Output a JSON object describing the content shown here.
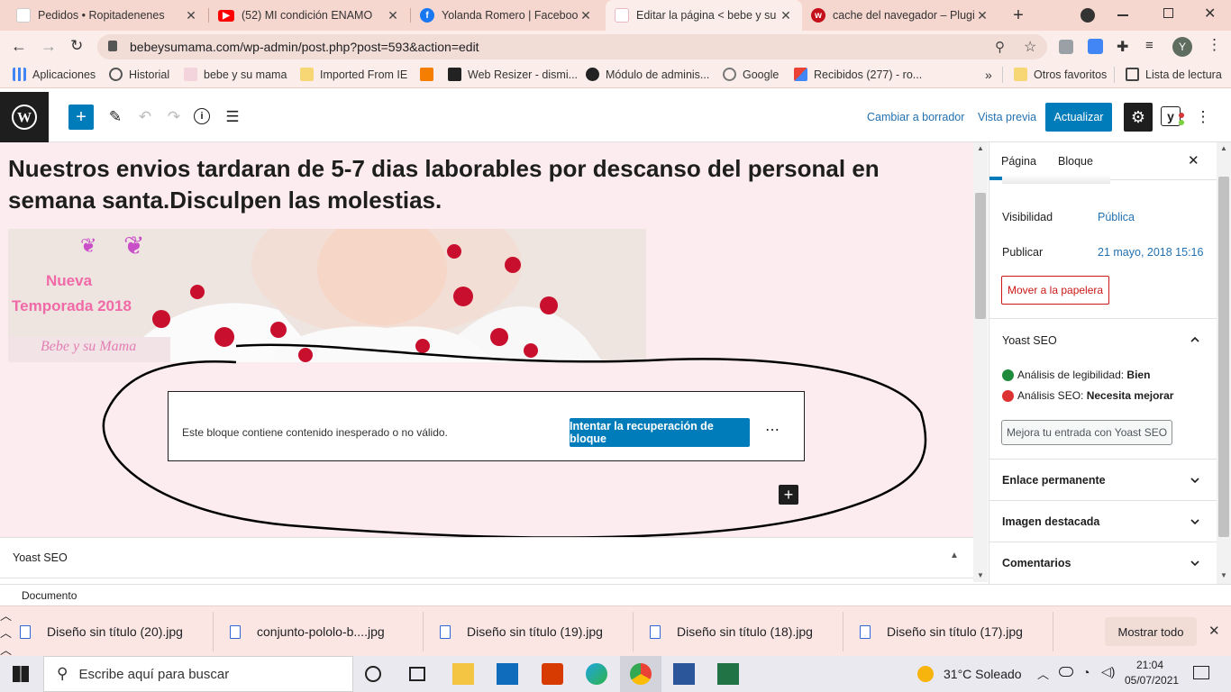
{
  "browser": {
    "tabs": [
      {
        "title": "Pedidos • Ropitadenenes",
        "icon": "page-icon",
        "active": false
      },
      {
        "title": "(52) MI condición ENAMO",
        "icon": "youtube-icon",
        "active": false
      },
      {
        "title": "Yolanda Romero | Facebook",
        "icon": "facebook-icon",
        "active": false
      },
      {
        "title": "Editar la página < bebe y su n",
        "icon": "site-icon",
        "active": true
      },
      {
        "title": "cache del navegador – Plugin",
        "icon": "plugin-icon",
        "active": false
      }
    ],
    "url": "bebeysumama.com/wp-admin/post.php?post=593&action=edit",
    "profile_initial": "Y",
    "bookmarks": [
      {
        "label": "Aplicaciones",
        "icon": "apps-icon"
      },
      {
        "label": "Historial",
        "icon": "history-icon"
      },
      {
        "label": "bebe y su mama",
        "icon": "site-icon"
      },
      {
        "label": "Imported From IE",
        "icon": "folder-icon"
      },
      {
        "label": "",
        "icon": "blogger-icon"
      },
      {
        "label": "Web Resizer - dismi...",
        "icon": "resizer-icon"
      },
      {
        "label": "Módulo de adminis...",
        "icon": "globe-icon"
      },
      {
        "label": "Google",
        "icon": "google-icon"
      },
      {
        "label": "Recibidos (277) - ro...",
        "icon": "gmail-icon"
      }
    ],
    "bookmarks_more": "»",
    "other_favorites": "Otros favoritos",
    "reading_list": "Lista de lectura"
  },
  "wp_header": {
    "switch_to_draft": "Cambiar a borrador",
    "preview": "Vista previa",
    "update": "Actualizar",
    "yoast_letter": "y"
  },
  "editor": {
    "title": "Nuestros envios tardaran de 5-7 dias laborables por descanso del personal en semana santa.Disculpen las molestias.",
    "hero": {
      "line1": "Nueva",
      "line2": "Temporada 2018",
      "signature": "Bebe y su Mama"
    },
    "invalid_block_message": "Este bloque contiene contenido inesperado o no válido.",
    "recover_button": "Intentar la recuperación de bloque",
    "more_options": "⋯",
    "yoast_metabox": "Yoast SEO",
    "footer_breadcrumb": "Documento"
  },
  "sidebar": {
    "tabs": [
      "Página",
      "Bloque"
    ],
    "visibility_label": "Visibilidad",
    "visibility_value": "Pública",
    "publish_label": "Publicar",
    "publish_value": "21 mayo, 2018 15:16",
    "trash_button": "Mover a la papelera",
    "yoast_title": "Yoast SEO",
    "readability_label": "Análisis de legibilidad:",
    "readability_value": "Bien",
    "seo_label": "Análisis SEO:",
    "seo_value": "Necesita mejorar",
    "improve_button": "Mejora tu entrada con Yoast SEO",
    "permalink": "Enlace permanente",
    "featured_image": "Imagen destacada",
    "comments": "Comentarios"
  },
  "downloads": {
    "items": [
      "Diseño sin título (20).jpg",
      "conjunto-pololo-b....jpg",
      "Diseño sin título (19).jpg",
      "Diseño sin título (18).jpg",
      "Diseño sin título (17).jpg"
    ],
    "show_all": "Mostrar todo"
  },
  "taskbar": {
    "search_placeholder": "Escribe aquí para buscar",
    "weather": "31°C  Soleado",
    "time": "21:04",
    "date": "05/07/2021"
  },
  "colors": {
    "wp_blue": "#007cba",
    "link_blue": "#2271b1",
    "canvas_bg": "#fcecef",
    "chrome_tab_bg": "#f6d7cf",
    "good": "#1e8c3a",
    "bad": "#dc3232"
  }
}
